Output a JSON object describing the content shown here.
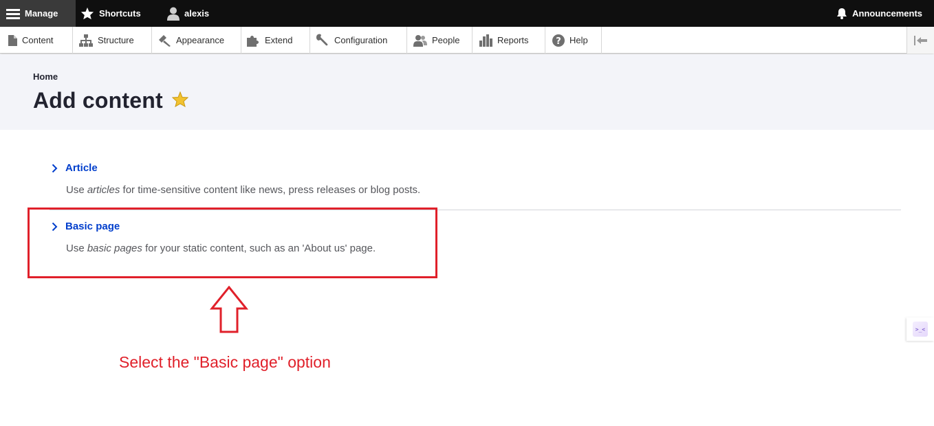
{
  "toolbar": {
    "manage_label": "Manage",
    "shortcuts_label": "Shortcuts",
    "user_label": "alexis",
    "announcements_label": "Announcements"
  },
  "tray": {
    "items": [
      {
        "label": "Content",
        "icon": "page-icon"
      },
      {
        "label": "Structure",
        "icon": "sitemap-icon"
      },
      {
        "label": "Appearance",
        "icon": "paintbrush-icon"
      },
      {
        "label": "Extend",
        "icon": "puzzle-icon"
      },
      {
        "label": "Configuration",
        "icon": "wrench-icon"
      },
      {
        "label": "People",
        "icon": "people-icon"
      },
      {
        "label": "Reports",
        "icon": "bar-chart-icon"
      },
      {
        "label": "Help",
        "icon": "help-icon"
      }
    ]
  },
  "header": {
    "breadcrumb": "Home",
    "title": "Add content"
  },
  "content_types": [
    {
      "label": "Article",
      "desc_before": "Use ",
      "desc_em": "articles",
      "desc_after": " for time-sensitive content like news, press releases or blog posts."
    },
    {
      "label": "Basic page",
      "desc_before": "Use ",
      "desc_em": "basic pages",
      "desc_after": " for your static content, such as an 'About us' page."
    }
  ],
  "annotation": {
    "text": "Select the \"Basic page\" option",
    "color": "#e0202a"
  },
  "colors": {
    "toolbar_bg": "#0f0f0f",
    "link": "#003ecc",
    "header_bg": "#f3f4f9",
    "star": "#f2c230"
  }
}
